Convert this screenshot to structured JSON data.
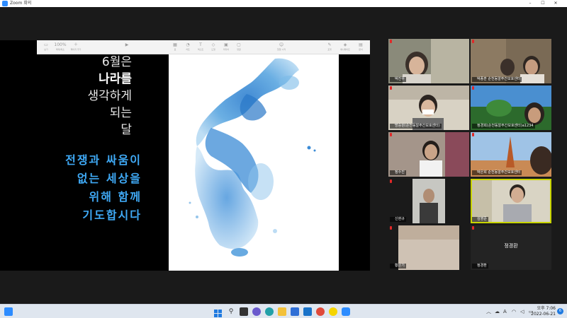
{
  "window": {
    "title": "Zoom 회의"
  },
  "presentation": {
    "toolbar_items": [
      "보기",
      "확대/축소",
      "페이지 추가",
      "표",
      "차트",
      "텍스트",
      "도형",
      "미디어",
      "댓글",
      "협업 시작",
      "포맷",
      "애니메이트",
      "문서"
    ],
    "zoom": "100%",
    "poem_lines": [
      "6월은",
      "나라를",
      "생각하게",
      "되는",
      "달"
    ],
    "prayer_lines": [
      "전쟁과 싸움이",
      "없는 세상을",
      "위해 함께",
      "기도합시다"
    ]
  },
  "participants": [
    {
      "name": "박진우",
      "muted": true
    },
    {
      "name": "박종훈 순천동알주간보호센터",
      "muted": true
    },
    {
      "name": "방승원(순천동알주간보호센터)",
      "muted": true
    },
    {
      "name": "정경희(순천동알주간보호센터)a1234",
      "muted": true
    },
    {
      "name": "정수진",
      "muted": true
    },
    {
      "name": "박은희 순천동알주간보호센터",
      "muted": true
    },
    {
      "name": "신현규",
      "muted": true
    },
    {
      "name": "김영준",
      "muted": false,
      "active": true
    },
    {
      "name": "황은기",
      "muted": true
    },
    {
      "name": "정경환",
      "muted": true,
      "video_off_name": "정경환"
    }
  ],
  "taskbar": {
    "time": "오후 7:06",
    "date": "2022-06-21",
    "notifications": "6"
  },
  "colors": {
    "accent": "#2d8cff",
    "prayer_text": "#3fa9f5",
    "active_speaker": "#c8d400",
    "mute": "#e02828"
  }
}
